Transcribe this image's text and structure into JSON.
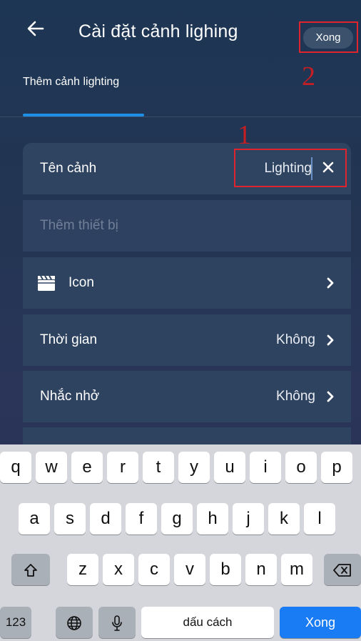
{
  "header": {
    "title": "Cài đặt cảnh lighing",
    "done_label": "Xong",
    "tab_label": "Thêm cảnh lighting",
    "annotation_done": "2"
  },
  "form": {
    "name_row": {
      "label": "Tên cảnh",
      "value": "Lighting",
      "annotation": "1"
    },
    "device_row": {
      "placeholder": "Thêm thiết bị"
    },
    "icon_row": {
      "label": "Icon"
    },
    "time_row": {
      "label": "Thời gian",
      "value": "Không"
    },
    "remind_row": {
      "label": "Nhắc nhở",
      "value": "Không"
    }
  },
  "keyboard": {
    "row1": [
      "q",
      "w",
      "e",
      "r",
      "t",
      "y",
      "u",
      "i",
      "o",
      "p"
    ],
    "row2": [
      "a",
      "s",
      "d",
      "f",
      "g",
      "h",
      "j",
      "k",
      "l"
    ],
    "row3": [
      "z",
      "x",
      "c",
      "v",
      "b",
      "n",
      "m"
    ],
    "numbers_label": "123",
    "space_label": "dấu cách",
    "return_label": "Xong"
  },
  "colors": {
    "accent": "#1e8fe6",
    "annotation": "#e0242d",
    "return_key": "#1a7cf5"
  }
}
